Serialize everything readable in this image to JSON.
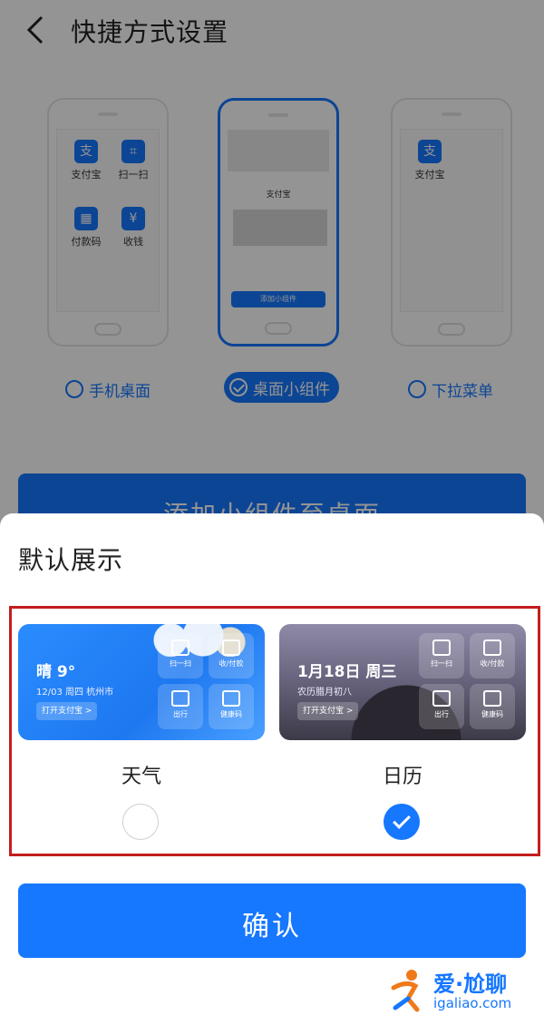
{
  "nav": {
    "title": "快捷方式设置",
    "back_icon": "chevron-left-icon"
  },
  "previews": {
    "phone_desktop_apps": [
      "支付宝",
      "扫一扫",
      "付款码",
      "收钱"
    ],
    "widget": {
      "card_title": "支付宝",
      "add_label": "添加小组件"
    },
    "dropdown_apps": [
      "支付宝"
    ]
  },
  "options": [
    {
      "label": "手机桌面",
      "selected": false
    },
    {
      "label": "桌面小组件",
      "selected": true
    },
    {
      "label": "下拉菜单",
      "selected": false
    }
  ],
  "add_button_label": "添加小组件至桌面",
  "sheet": {
    "title": "默认展示",
    "weather": {
      "main": "晴 9°",
      "sub": "12/03 周四 杭州市",
      "open": "打开支付宝 >",
      "tiles": [
        "扫一扫",
        "收/付款",
        "出行",
        "健康码"
      ],
      "label": "天气",
      "selected": false
    },
    "calendar": {
      "main": "1月18日 周三",
      "sub": "农历腊月初八",
      "open": "打开支付宝 >",
      "tiles": [
        "扫一扫",
        "收/付款",
        "出行",
        "健康码"
      ],
      "label": "日历",
      "selected": true
    },
    "confirm_label": "确认"
  },
  "watermark": {
    "cn": "爱·尬聊",
    "en": "igaliao.com"
  },
  "colors": {
    "accent": "#1677ff",
    "highlight_border": "#c31e1e"
  }
}
